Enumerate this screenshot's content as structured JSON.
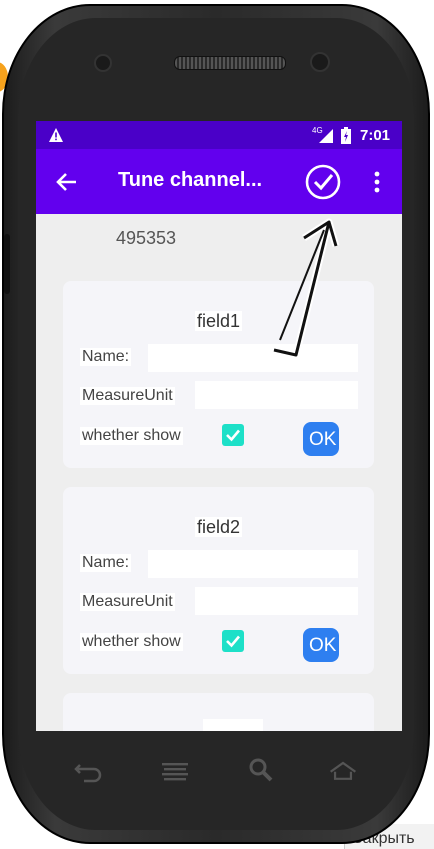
{
  "statusbar": {
    "network": "4G",
    "time": "7:01"
  },
  "appbar": {
    "title": "Tune channel..."
  },
  "channel_id": "495353",
  "fields": [
    {
      "title": "field1",
      "name_label": "Name:",
      "name_value": "",
      "unit_label": "MeasureUnit",
      "unit_value": "",
      "show_label": "whether show",
      "show_checked": true,
      "ok_label": "OK"
    },
    {
      "title": "field2",
      "name_label": "Name:",
      "name_value": "",
      "unit_label": "MeasureUnit",
      "unit_value": "",
      "show_label": "whether show",
      "show_checked": true,
      "ok_label": "OK"
    }
  ],
  "background": {
    "close_label": "Закрыть"
  },
  "icons": {
    "back": "arrow-left-icon",
    "confirm": "check-circle-icon",
    "more": "more-vert-icon",
    "warning": "warning-icon",
    "signal": "signal-icon",
    "battery": "battery-icon",
    "nav_back": "back-icon",
    "nav_menu": "menu-icon",
    "nav_search": "search-icon",
    "nav_home": "home-icon"
  },
  "colors": {
    "statusbar": "#4a00c8",
    "appbar": "#6200ee",
    "checkbox": "#1de0c8",
    "ok_button": "#2e7ff0"
  }
}
